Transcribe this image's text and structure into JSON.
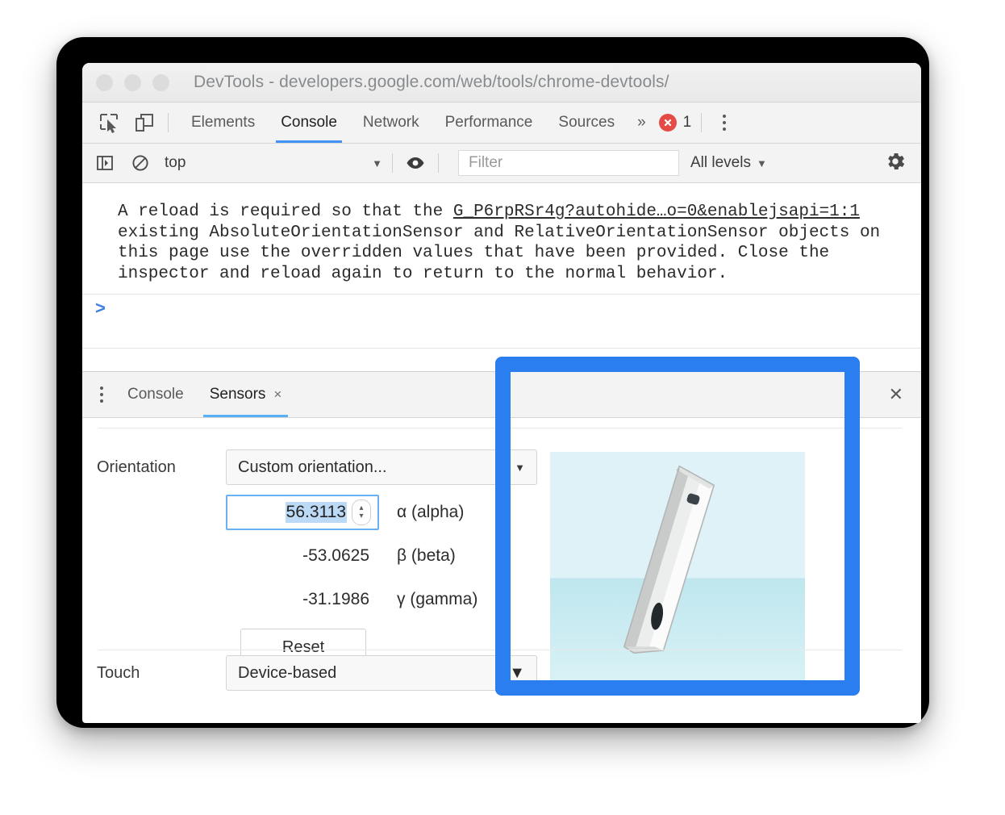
{
  "window": {
    "title": "DevTools - developers.google.com/web/tools/chrome-devtools/",
    "traffic_lights": [
      "close",
      "minimize",
      "zoom"
    ]
  },
  "main_tabs": {
    "inspect_icon": "inspect-element-icon",
    "device_icon": "device-toolbar-icon",
    "items": [
      {
        "label": "Elements",
        "active": false
      },
      {
        "label": "Console",
        "active": true
      },
      {
        "label": "Network",
        "active": false
      },
      {
        "label": "Performance",
        "active": false
      },
      {
        "label": "Sources",
        "active": false
      }
    ],
    "overflow": "»",
    "error_count": "1",
    "error_color": "#e44b45",
    "more_icon": "kebab-menu-icon"
  },
  "console_toolbar": {
    "sidebar_icon": "show-console-sidebar-icon",
    "clear_icon": "clear-console-icon",
    "context": "top",
    "context_caret": "▼",
    "eye_icon": "live-expression-icon",
    "filter_placeholder": "Filter",
    "filter_value": "",
    "levels": "All levels",
    "levels_caret": "▼",
    "settings_icon": "gear-icon"
  },
  "console": {
    "message": {
      "line1_before": "A reload is required so that the ",
      "link": "G_P6rpRSr4g?autohide…o=0&enablejsapi=1:1",
      "rest": "existing AbsoluteOrientationSensor and RelativeOrientationSensor objects on this page use the overridden values that have been provided. Close the inspector and reload again to return to the normal behavior."
    },
    "prompt": ">"
  },
  "drawer": {
    "menu_icon": "kebab-menu-icon",
    "tabs": [
      {
        "label": "Console",
        "active": false,
        "closable": false
      },
      {
        "label": "Sensors",
        "active": true,
        "closable": true
      }
    ],
    "close_glyph": "×",
    "close_drawer_glyph": "✕"
  },
  "sensors": {
    "orientation_label": "Orientation",
    "orientation_value": "Custom orientation...",
    "orientation_caret": "▼",
    "fields": [
      {
        "value": "56.3113",
        "axis": "α (alpha)",
        "editable": true,
        "selected": true
      },
      {
        "value": "-53.0625",
        "axis": "β (beta)",
        "editable": false,
        "selected": false
      },
      {
        "value": "-31.1986",
        "axis": "γ (gamma)",
        "editable": false,
        "selected": false
      }
    ],
    "reset_label": "Reset",
    "touch_label": "Touch",
    "touch_value": "Device-based",
    "touch_caret": "▼",
    "spinner_up": "▴",
    "spinner_down": "▾"
  },
  "annotation": {
    "color": "#2a7ef0",
    "name": "orientation-preview-highlight"
  }
}
